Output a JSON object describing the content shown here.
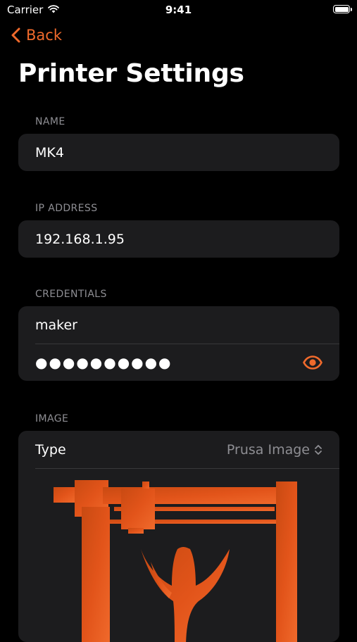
{
  "status_bar": {
    "carrier": "Carrier",
    "time": "9:41",
    "wifi_icon": "wifi-icon",
    "battery_icon": "battery-icon"
  },
  "nav": {
    "back_label": "Back",
    "back_icon": "chevron-left-icon"
  },
  "page": {
    "title": "Printer Settings"
  },
  "sections": {
    "name": {
      "header": "NAME",
      "value": "MK4"
    },
    "ip_address": {
      "header": "IP ADDRESS",
      "value": "192.168.1.95"
    },
    "credentials": {
      "header": "CREDENTIALS",
      "username": "maker",
      "password_masked": "●●●●●●●●●●",
      "reveal_icon": "eye-icon"
    },
    "image": {
      "header": "IMAGE",
      "type_label": "Type",
      "type_value": "Prusa Image",
      "picker_icon": "chevron-up-down-icon",
      "image_name": "prusa-printer-image"
    }
  },
  "colors": {
    "accent": "#f06a2c",
    "background": "#000000",
    "cell": "#1c1c1e",
    "secondary_text": "#8e8e93",
    "separator": "#38383a"
  }
}
